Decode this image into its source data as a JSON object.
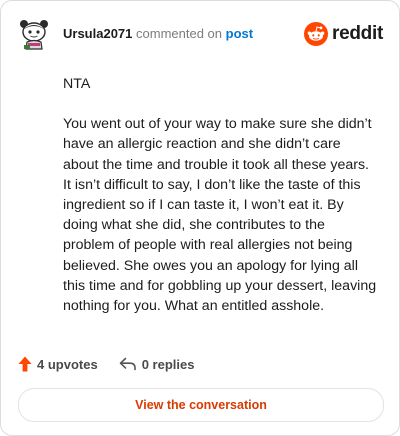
{
  "comment": {
    "username": "Ursula2071",
    "action_text": "commented on",
    "post_link": "post",
    "paragraphs": [
      "NTA",
      "You went out of your way to make sure she didn’t have an allergic reaction and she didn’t care about the time and trouble it took all these years. It isn’t difficult to say, I don’t like the taste of this ingredient so if I can taste it, I won’t eat it. By doing what she did, she contributes to the problem of people with real allergies not being believed. She owes you an apology for lying all this time and for gobbling up your dessert, leaving nothing for you. What an entitled asshole."
    ],
    "upvotes_label": "4 upvotes",
    "replies_label": "0 replies"
  },
  "brand": {
    "wordmark": "reddit",
    "icon": "reddit-logo-icon",
    "color": "#ff4500"
  },
  "cta": {
    "label": "View the conversation"
  },
  "icons": {
    "avatar": "snoo-avatar-icon",
    "upvote": "upvote-arrow-icon",
    "reply": "reply-arrow-icon"
  },
  "colors": {
    "link": "#0079d3",
    "cta_text": "#d93a00",
    "upvote": "#ff4500",
    "text": "#1c1c1c",
    "muted": "#7c7c7c"
  }
}
